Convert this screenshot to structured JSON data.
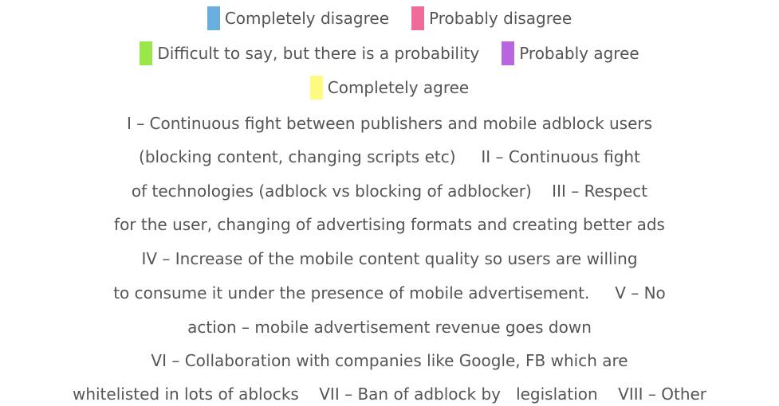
{
  "chart_data": {
    "type": "bar",
    "legend": [
      {
        "label": "Completely disagree",
        "color": "#6aaee0"
      },
      {
        "label": "Probably disagree",
        "color": "#f06a9a"
      },
      {
        "label": "Difficult to say, but there is a probability",
        "color": "#99e84a"
      },
      {
        "label": "Probably agree",
        "color": "#b865e0"
      },
      {
        "label": "Completely agree",
        "color": "#fffb80"
      }
    ],
    "legend_placement": "top-center",
    "annotation_lines": [
      "I – Continuous fight between publishers and mobile adblock users",
      "(blocking content, changing scripts etc)     II – Continuous fight",
      "of technologies (adblock vs blocking of adblocker)    III – Respect",
      "for the user, changing of advertising formats and creating better ads",
      "IV – Increase of the mobile content quality so users are willing",
      "to consume it under the presence of mobile advertisement.     V – No",
      "action – mobile advertisement revenue goes down",
      "VI – Collaboration with companies like Google, FB which are",
      "whitelisted in lots of ablocks    VII – Ban of adblock by   legislation    VIII – Other"
    ]
  }
}
